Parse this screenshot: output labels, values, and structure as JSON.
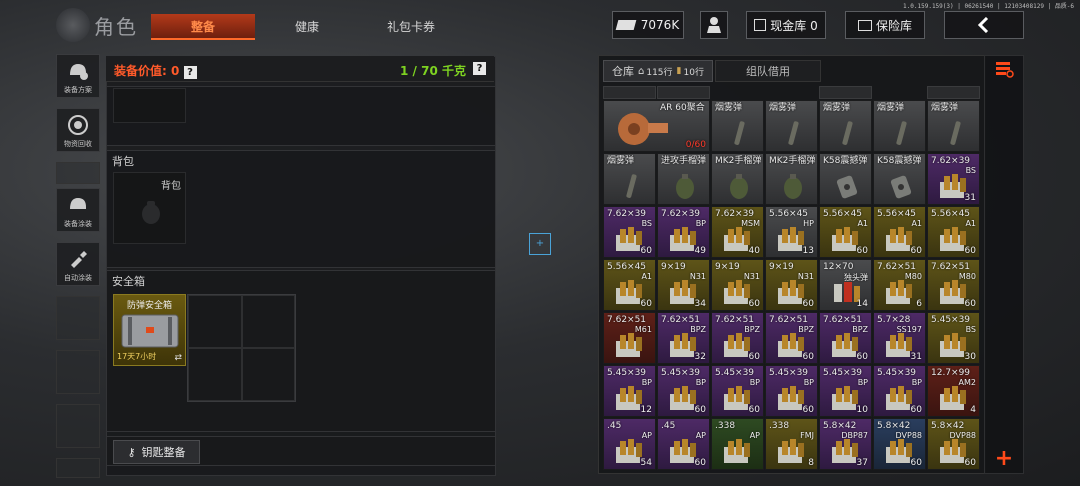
{
  "version": "1.0.159.159(3) | 06261540 | 12103408129 | 品质-6",
  "header": {
    "title": "角色",
    "tabs": [
      {
        "label": "整备",
        "active": true
      },
      {
        "label": "健康",
        "active": false
      },
      {
        "label": "礼包卡券",
        "active": false
      }
    ],
    "currency": "7076K",
    "cash_vault": "现金库 0",
    "insurance_vault": "保险库"
  },
  "left_menu": {
    "loadout_plan": "装备方案",
    "recycle": "物资回收",
    "skins": "装备涂装",
    "auto_skin": "自动涂装"
  },
  "equipment": {
    "value_label": "装备价值: 0",
    "weight_label": "1 / 70 千克",
    "backpack_section": "背包",
    "backpack_slot": "背包",
    "safe_section": "安全箱",
    "safe_item_name": "防弹安全箱",
    "safe_item_time": "17天7小时",
    "key_button": "钥匙整备"
  },
  "drop_target": "+",
  "warehouse": {
    "tab_label": "仓库",
    "rows_a": "115行",
    "rows_b": "10行",
    "team_tab": "组队借用",
    "rows": [
      [
        {
          "name": "AR 60聚合",
          "qty": "0/60",
          "qty_red": true,
          "bg": "gray",
          "pic": "drum",
          "span": 2
        },
        {
          "name": "烟雾弹",
          "qty": "",
          "bg": "gray",
          "pic": "smoke"
        },
        {
          "name": "烟雾弹",
          "qty": "",
          "bg": "gray",
          "pic": "smoke"
        },
        {
          "name": "烟雾弹",
          "qty": "",
          "bg": "gray",
          "pic": "smoke"
        },
        {
          "name": "烟雾弹",
          "qty": "",
          "bg": "gray",
          "pic": "smoke"
        },
        {
          "name": "烟雾弹",
          "qty": "",
          "bg": "gray",
          "pic": "smoke"
        }
      ],
      [
        {
          "name": "烟雾弹",
          "qty": "",
          "bg": "gray",
          "pic": "smoke"
        },
        {
          "name": "进攻手榴弹",
          "qty": "",
          "bg": "gray",
          "pic": "grenade"
        },
        {
          "name": "MK2手榴弹",
          "qty": "",
          "bg": "gray",
          "pic": "grenade"
        },
        {
          "name": "MK2手榴弹",
          "qty": "",
          "bg": "gray",
          "pic": "grenade"
        },
        {
          "name": "K58震撼弹",
          "qty": "",
          "bg": "gray",
          "pic": "flash"
        },
        {
          "name": "K58震撼弹",
          "qty": "",
          "bg": "gray",
          "pic": "flash"
        },
        {
          "name": "7.62×39",
          "sub": "BS",
          "qty": "31",
          "bg": "purple",
          "pic": "ammo"
        }
      ],
      [
        {
          "name": "7.62×39",
          "sub": "BS",
          "qty": "60",
          "bg": "purple",
          "pic": "ammo"
        },
        {
          "name": "7.62×39",
          "sub": "BP",
          "qty": "49",
          "bg": "purple",
          "pic": "ammo"
        },
        {
          "name": "7.62×39",
          "sub": "MSM",
          "qty": "40",
          "bg": "gold",
          "pic": "ammo"
        },
        {
          "name": "5.56×45",
          "sub": "HP",
          "qty": "13",
          "bg": "gray",
          "pic": "ammo"
        },
        {
          "name": "5.56×45",
          "sub": "A1",
          "qty": "60",
          "bg": "gold",
          "pic": "ammo"
        },
        {
          "name": "5.56×45",
          "sub": "A1",
          "qty": "60",
          "bg": "gold",
          "pic": "ammo"
        },
        {
          "name": "5.56×45",
          "sub": "A1",
          "qty": "60",
          "bg": "gold",
          "pic": "ammo"
        }
      ],
      [
        {
          "name": "5.56×45",
          "sub": "A1",
          "qty": "60",
          "bg": "gold",
          "pic": "ammo"
        },
        {
          "name": "9×19",
          "sub": "N31",
          "qty": "34",
          "bg": "gold",
          "pic": "ammo"
        },
        {
          "name": "9×19",
          "sub": "N31",
          "qty": "60",
          "bg": "gold",
          "pic": "ammo"
        },
        {
          "name": "9×19",
          "sub": "N31",
          "qty": "60",
          "bg": "gold",
          "pic": "ammo"
        },
        {
          "name": "12×70",
          "sub": "独头弹",
          "qty": "14",
          "bg": "gray",
          "pic": "shell"
        },
        {
          "name": "7.62×51",
          "sub": "M80",
          "qty": "6",
          "bg": "gold",
          "pic": "ammo"
        },
        {
          "name": "7.62×51",
          "sub": "M80",
          "qty": "60",
          "bg": "gold",
          "pic": "ammo"
        }
      ],
      [
        {
          "name": "7.62×51",
          "sub": "M61",
          "qty": "",
          "bg": "red",
          "pic": "ammo"
        },
        {
          "name": "7.62×51",
          "sub": "BPZ",
          "qty": "32",
          "bg": "purple",
          "pic": "ammo"
        },
        {
          "name": "7.62×51",
          "sub": "BPZ",
          "qty": "60",
          "bg": "purple",
          "pic": "ammo"
        },
        {
          "name": "7.62×51",
          "sub": "BPZ",
          "qty": "60",
          "bg": "purple",
          "pic": "ammo"
        },
        {
          "name": "7.62×51",
          "sub": "BPZ",
          "qty": "60",
          "bg": "purple",
          "pic": "ammo"
        },
        {
          "name": "5.7×28",
          "sub": "SS197",
          "qty": "31",
          "bg": "purple",
          "pic": "ammo"
        },
        {
          "name": "5.45×39",
          "sub": "BS",
          "qty": "30",
          "bg": "gold",
          "pic": "ammo"
        }
      ],
      [
        {
          "name": "5.45×39",
          "sub": "BP",
          "qty": "12",
          "bg": "purple",
          "pic": "ammo"
        },
        {
          "name": "5.45×39",
          "sub": "BP",
          "qty": "60",
          "bg": "purple",
          "pic": "ammo"
        },
        {
          "name": "5.45×39",
          "sub": "BP",
          "qty": "60",
          "bg": "purple",
          "pic": "ammo"
        },
        {
          "name": "5.45×39",
          "sub": "BP",
          "qty": "60",
          "bg": "purple",
          "pic": "ammo"
        },
        {
          "name": "5.45×39",
          "sub": "BP",
          "qty": "10",
          "bg": "purple",
          "pic": "ammo"
        },
        {
          "name": "5.45×39",
          "sub": "BP",
          "qty": "60",
          "bg": "purple",
          "pic": "ammo"
        },
        {
          "name": "12.7×99",
          "sub": "AM2",
          "qty": "4",
          "bg": "red",
          "pic": "ammo"
        }
      ],
      [
        {
          "name": ".45",
          "sub": "AP",
          "qty": "54",
          "bg": "purple",
          "pic": "ammo"
        },
        {
          "name": ".45",
          "sub": "AP",
          "qty": "60",
          "bg": "purple",
          "pic": "ammo"
        },
        {
          "name": ".338",
          "sub": "AP",
          "qty": "",
          "bg": "green",
          "pic": "ammo"
        },
        {
          "name": ".338",
          "sub": "FMJ",
          "qty": "8",
          "bg": "gold",
          "pic": "ammo"
        },
        {
          "name": "5.8×42",
          "sub": "DBP87",
          "qty": "37",
          "bg": "purple",
          "pic": "ammo"
        },
        {
          "name": "5.8×42",
          "sub": "DVP88",
          "qty": "60",
          "bg": "blue",
          "pic": "ammo"
        },
        {
          "name": "5.8×42",
          "sub": "DVP88",
          "qty": "60",
          "bg": "gold",
          "pic": "ammo"
        }
      ]
    ]
  },
  "add_button": "+"
}
